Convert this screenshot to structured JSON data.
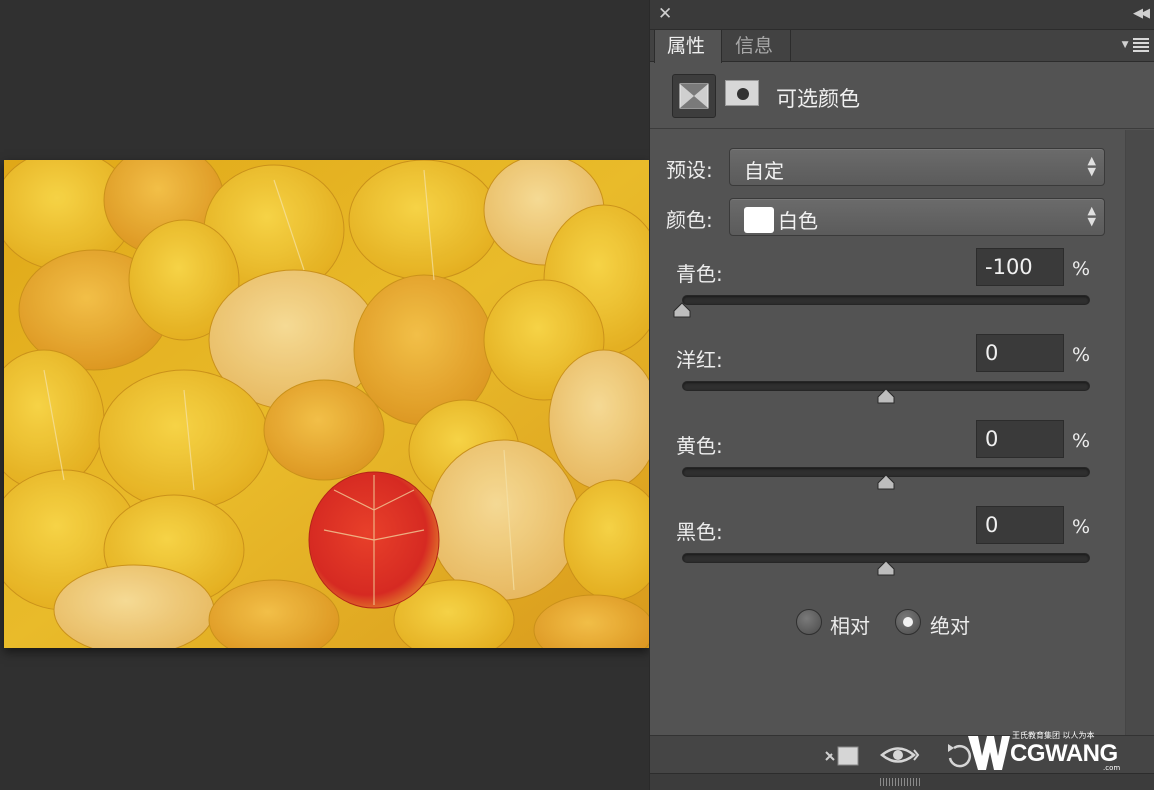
{
  "panel": {
    "tabs": [
      {
        "label": "属性",
        "active": true
      },
      {
        "label": "信息",
        "active": false
      }
    ],
    "adjustment_title": "可选颜色",
    "preset": {
      "label": "预设:",
      "value": "自定"
    },
    "color": {
      "label": "颜色:",
      "value": "白色",
      "swatch": "#ffffff"
    },
    "sliders": [
      {
        "label": "青色:",
        "value": "-100",
        "unit": "%",
        "level": -100
      },
      {
        "label": "洋红:",
        "value": "0",
        "unit": "%",
        "level": 0
      },
      {
        "label": "黄色:",
        "value": "0",
        "unit": "%",
        "level": 0
      },
      {
        "label": "黑色:",
        "value": "0",
        "unit": "%",
        "level": 0
      }
    ],
    "method": {
      "relative": {
        "label": "相对",
        "checked": false
      },
      "absolute": {
        "label": "绝对",
        "checked": true
      }
    },
    "toolbar_icons": [
      "clip-to-layer-icon",
      "eye-icon",
      "reset-icon",
      "visibility-icon",
      "trash-icon"
    ]
  },
  "watermark": {
    "subtitle": "王氏教育集团 以人为本",
    "brand": "CGWANG",
    "domain": ".com"
  },
  "colors": {
    "background": "#303030",
    "panel": "#535353",
    "field": "#3a3a3a"
  }
}
